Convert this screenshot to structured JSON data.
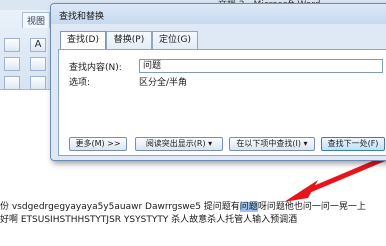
{
  "word": {
    "title": "文档 2 - Microsoft Word",
    "ribbon_tab_view": "视图",
    "ribbon_letter": "A"
  },
  "dialog": {
    "title": "查找和替换",
    "tabs": [
      {
        "label": "查找(D)",
        "active": true
      },
      {
        "label": "替换(P)",
        "active": false
      },
      {
        "label": "定位(G)",
        "active": false
      }
    ],
    "find_label": "查找内容(N):",
    "find_value": "问题",
    "options_label": "选项:",
    "options_value": "区分全/半角",
    "buttons": {
      "more": "更多(M) >>",
      "reading_highlight": "阅读突出显示(R) ▾",
      "find_in": "在以下项中查找(I) ▾",
      "find_next": "查找下一处(F)"
    }
  },
  "document": {
    "line1_prefix": "份 vsdgedrgegyayaya5y5auawr Dawrrgswe5 提问题有",
    "line1_highlight": "问题",
    "line1_suffix": "呀问题他也问一问一晃一上",
    "line2": "好啊 ETSUSIHSTHHSTYTJSR YSYSTYTY 杀人故意杀人托管人输入预调酒"
  },
  "colors": {
    "dialog_bg": "#dfe9f6",
    "highlight": "#9fc3ea",
    "arrow": "#e8141b"
  }
}
